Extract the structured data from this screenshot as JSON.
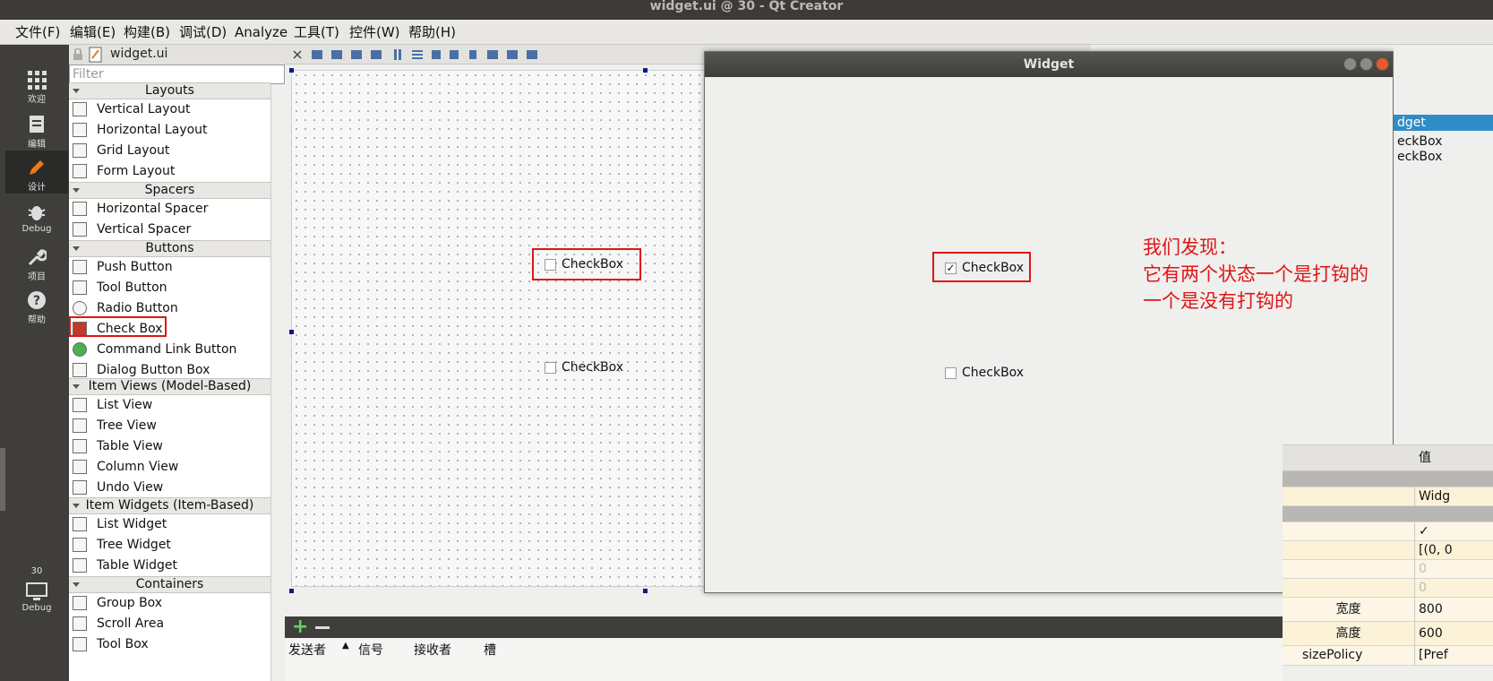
{
  "app": {
    "window_title": "widget.ui @ 30 - Qt Creator"
  },
  "menu": [
    "文件(F)",
    "编辑(E)",
    "构建(B)",
    "调试(D)",
    "Analyze",
    "工具(T)",
    "控件(W)",
    "帮助(H)"
  ],
  "modes": [
    {
      "label": "欢迎",
      "icon": "grid-icon"
    },
    {
      "label": "编辑",
      "icon": "document-icon"
    },
    {
      "label": "设计",
      "icon": "pencil-icon",
      "active": true
    },
    {
      "label": "Debug",
      "icon": "bug-icon"
    },
    {
      "label": "项目",
      "icon": "wrench-icon"
    },
    {
      "label": "帮助",
      "icon": "help-icon"
    }
  ],
  "kit": {
    "number": "30",
    "label": "Debug"
  },
  "editor": {
    "file_name": "widget.ui"
  },
  "widget_box": {
    "filter_placeholder": "Filter",
    "categories": {
      "layouts": "Layouts",
      "spacers": "Spacers",
      "buttons": "Buttons",
      "item_views": "Item Views (Model-Based)",
      "item_widgets": "Item Widgets (Item-Based)",
      "containers": "Containers"
    },
    "items": {
      "vertical_layout": "Vertical Layout",
      "horizontal_layout": "Horizontal Layout",
      "grid_layout": "Grid Layout",
      "form_layout": "Form Layout",
      "horizontal_spacer": "Horizontal Spacer",
      "vertical_spacer": "Vertical Spacer",
      "push_button": "Push Button",
      "tool_button": "Tool Button",
      "radio_button": "Radio Button",
      "check_box": "Check Box",
      "command_link_button": "Command Link Button",
      "dialog_button_box": "Dialog Button Box",
      "list_view": "List View",
      "tree_view": "Tree View",
      "table_view": "Table View",
      "column_view": "Column View",
      "undo_view": "Undo View",
      "list_widget": "List Widget",
      "tree_widget": "Tree Widget",
      "table_widget": "Table Widget",
      "group_box": "Group Box",
      "scroll_area": "Scroll Area",
      "tool_box": "Tool Box"
    }
  },
  "form": {
    "checkbox1": "CheckBox",
    "checkbox2": "CheckBox"
  },
  "preview": {
    "title": "Widget",
    "checkbox1": {
      "label": "CheckBox",
      "checked": true,
      "check_mark": "✓"
    },
    "checkbox2": {
      "label": "CheckBox",
      "checked": false
    }
  },
  "annotation": {
    "line1": "我们发现：",
    "line2": "它有两个状态一个是打钩的",
    "line3": "一个是没有打钩的"
  },
  "object_inspector": {
    "rows": [
      "dget",
      "eckBox",
      "eckBox"
    ]
  },
  "property_editor": {
    "value_header": "值",
    "rows": [
      {
        "key": "",
        "value": "Widg"
      },
      {
        "key": "",
        "value": "✓"
      },
      {
        "key": "",
        "value": "[(0, 0"
      },
      {
        "key": "",
        "value": "0"
      },
      {
        "key": "",
        "value": "0"
      },
      {
        "key": "宽度",
        "value": "800"
      },
      {
        "key": "高度",
        "value": "600"
      },
      {
        "key": "sizePolicy",
        "value": "[Pref"
      }
    ]
  },
  "signal_slot": {
    "columns": [
      "发送者",
      "信号",
      "接收者",
      "槽"
    ]
  },
  "colors": {
    "accent_red": "#e01515",
    "selection_blue": "#308cc6"
  }
}
